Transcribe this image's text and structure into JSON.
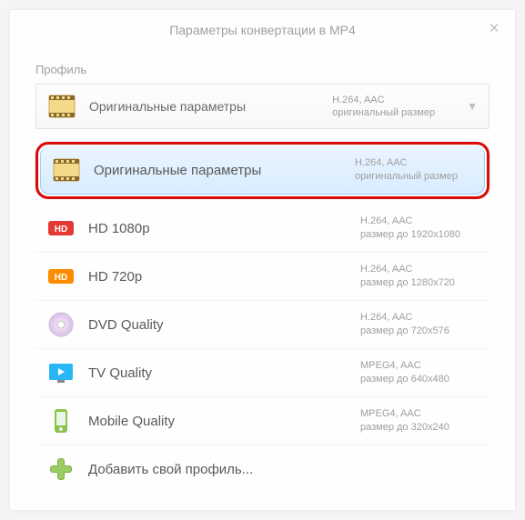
{
  "window": {
    "title": "Параметры конвертации в MP4"
  },
  "section_label": "Профиль",
  "selected": {
    "name": "Оригинальные параметры",
    "codec": "H.264, AAC",
    "size": "оригинальный размер"
  },
  "items": [
    {
      "name": "Оригинальные параметры",
      "codec": "H.264, AAC",
      "size": "оригинальный размер",
      "icon": "film"
    },
    {
      "name": "HD 1080p",
      "codec": "H.264, AAC",
      "size": "размер до 1920х1080",
      "icon": "hd-red"
    },
    {
      "name": "HD 720p",
      "codec": "H.264, AAC",
      "size": "размер до 1280х720",
      "icon": "hd-orange"
    },
    {
      "name": "DVD Quality",
      "codec": "H.264, AAC",
      "size": "размер до 720х576",
      "icon": "disc"
    },
    {
      "name": "TV Quality",
      "codec": "MPEG4, AAC",
      "size": "размер до 640х480",
      "icon": "tv"
    },
    {
      "name": "Mobile Quality",
      "codec": "MPEG4, AAC",
      "size": "размер до 320х240",
      "icon": "mobile"
    },
    {
      "name": "Добавить свой профиль...",
      "codec": "",
      "size": "",
      "icon": "plus"
    }
  ]
}
